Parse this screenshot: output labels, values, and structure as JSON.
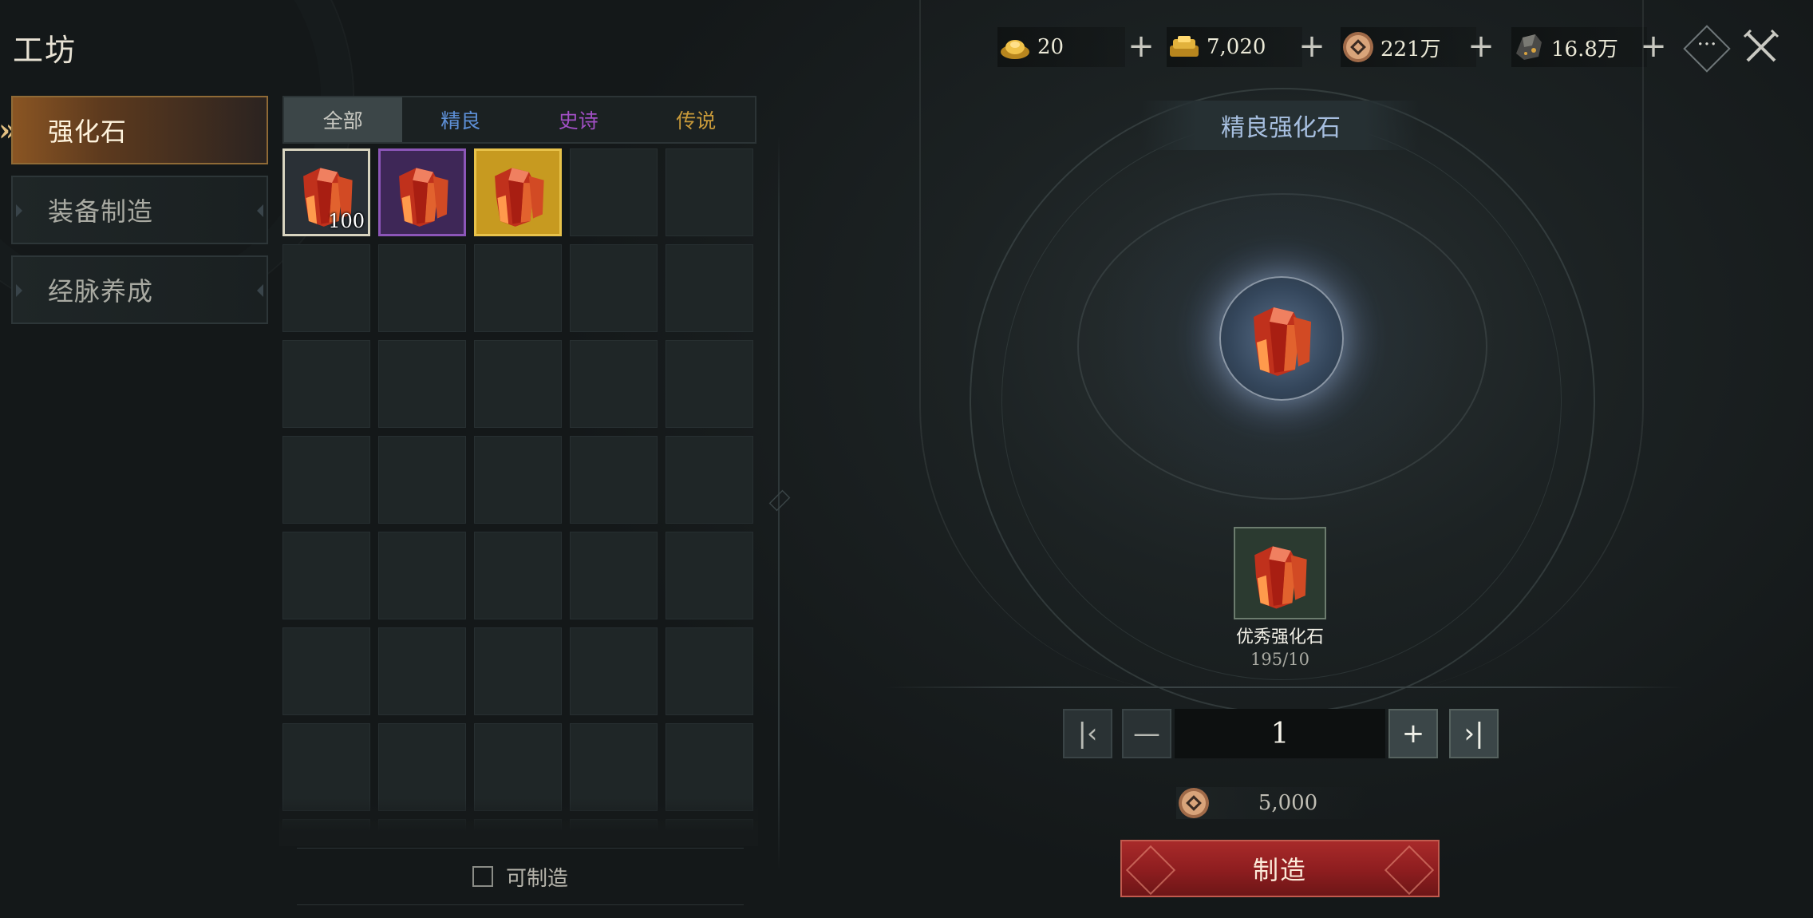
{
  "header": {
    "title": "工坊"
  },
  "sidebar": {
    "items": [
      {
        "label": "强化石",
        "active": true
      },
      {
        "label": "装备制造",
        "active": false
      },
      {
        "label": "经脉养成",
        "active": false
      }
    ]
  },
  "tabs": [
    {
      "label": "全部",
      "color": "#c9c9c2",
      "active": true
    },
    {
      "label": "精良",
      "color": "#5d8fd6",
      "active": false
    },
    {
      "label": "史诗",
      "color": "#a14fc4",
      "active": false
    },
    {
      "label": "传说",
      "color": "#c99a3a",
      "active": false
    }
  ],
  "grid": {
    "items": [
      {
        "icon": "red-crystal-icon",
        "rarity": "common",
        "border": "#d8d4c0",
        "bg": "#2a3036",
        "count": "100"
      },
      {
        "icon": "red-crystal-icon",
        "rarity": "epic",
        "border": "#8c56b8",
        "bg": "#3e2757",
        "count": ""
      },
      {
        "icon": "red-crystal-icon",
        "rarity": "legendary",
        "border": "#e8c24a",
        "bg": "#c79a20",
        "count": ""
      }
    ]
  },
  "filter": {
    "craftable_label": "可制造",
    "checked": false
  },
  "currencies": [
    {
      "icon": "gold-ingot-icon",
      "value": "20"
    },
    {
      "icon": "gold-bars-icon",
      "value": "7,020"
    },
    {
      "icon": "copper-coin-icon",
      "value": "221万"
    },
    {
      "icon": "ore-icon",
      "value": "16.8万"
    }
  ],
  "detail": {
    "item_name": "精良强化石",
    "material": {
      "name": "优秀强化石",
      "count": "195/10"
    },
    "quantity": "1",
    "cost": "5,000",
    "craft_label": "制造"
  }
}
